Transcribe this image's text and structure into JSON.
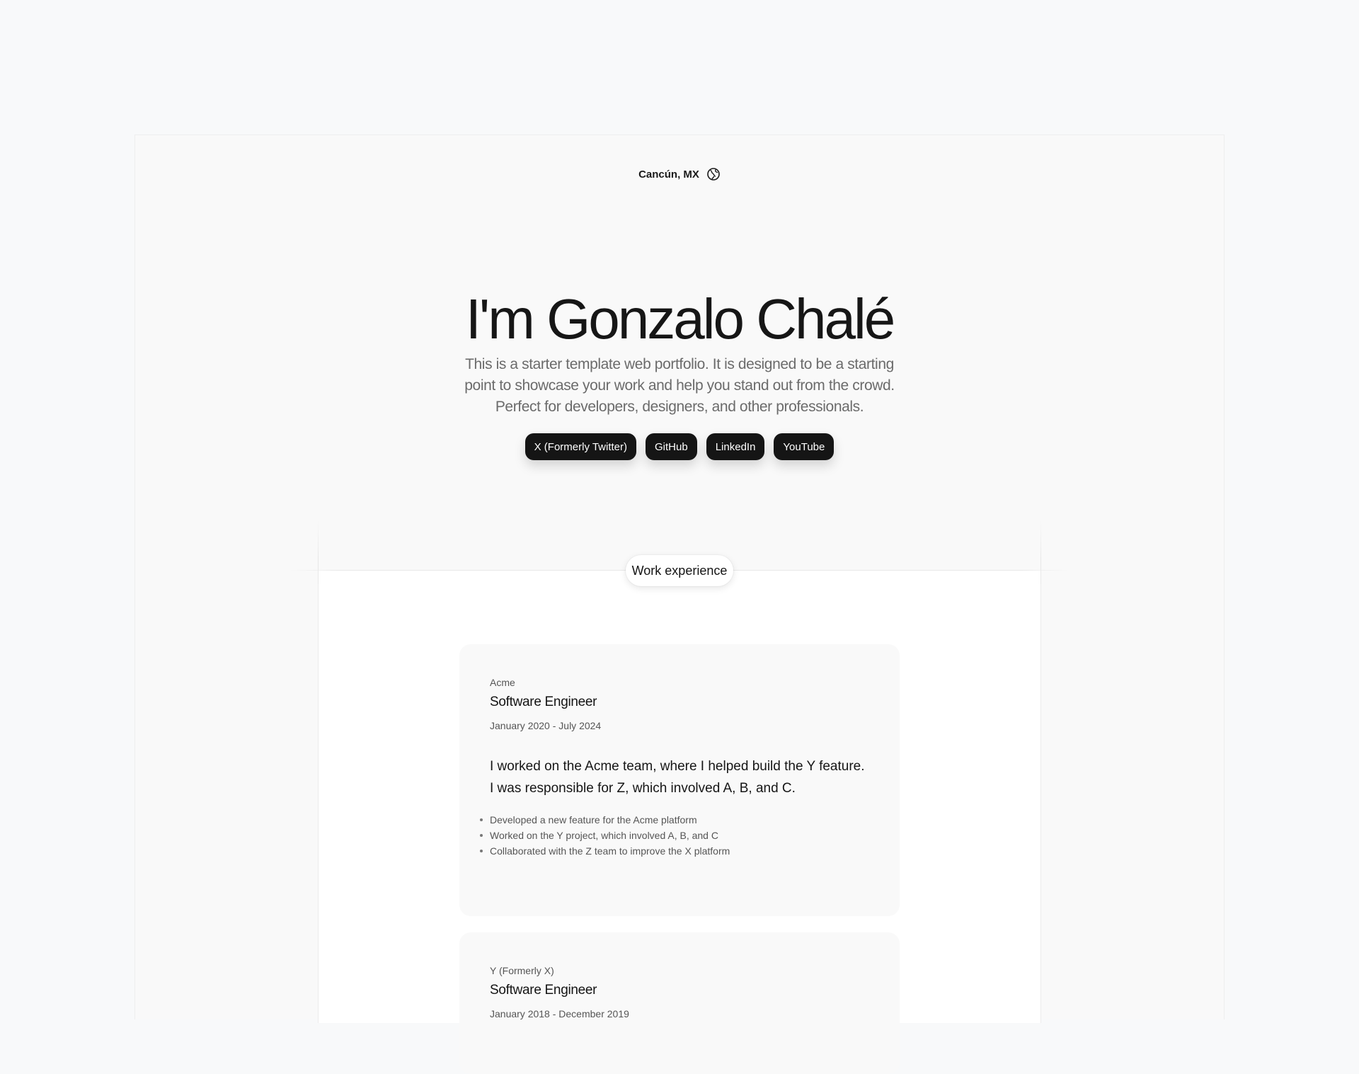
{
  "header": {
    "location": "Cancún, MX",
    "location_icon": "globe-icon"
  },
  "hero": {
    "title": "I'm Gonzalo Chalé",
    "description": "This is a starter template web portfolio. It is designed to be a starting point to showcase your work and help you stand out from the crowd. Perfect for developers, designers, and other professionals.",
    "socials": [
      {
        "label": "X (Formerly Twitter)"
      },
      {
        "label": "GitHub"
      },
      {
        "label": "LinkedIn"
      },
      {
        "label": "YouTube"
      }
    ]
  },
  "work": {
    "section_label": "Work experience",
    "jobs": [
      {
        "company": "Acme",
        "role": "Software Engineer",
        "dates": "January 2020 - July 2024",
        "summary": "I worked on the Acme team, where I helped build the Y feature. I was responsible for Z, which involved A, B, and C.",
        "bullets": [
          "Developed a new feature for the Acme platform",
          "Worked on the Y project, which involved A, B, and C",
          "Collaborated with the Z team to improve the X platform"
        ]
      },
      {
        "company": "Y (Formerly X)",
        "role": "Software Engineer",
        "dates": "January 2018 - December 2019"
      }
    ]
  },
  "colors": {
    "background": "#f8f9fa",
    "button_dark": "#151515",
    "card": "#f9f9f9",
    "text_muted": "#6b6b6b"
  }
}
